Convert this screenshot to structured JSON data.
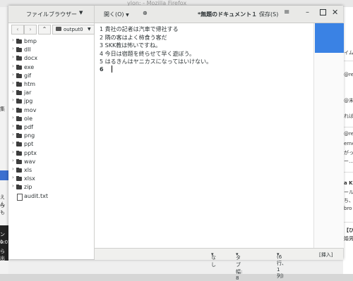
{
  "background": {
    "window_title": "ylon: - Mozilla Firefox",
    "left_fragments": [
      "集",
      "えん",
      "らも",
      "ンレ",
      "0.07",
      "ら出"
    ],
    "right_fragments": [
      "イム",
      "@re",
      "@末",
      "れば",
      "@re",
      "erne",
      "がっ",
      "ー…",
      "a K",
      "ール",
      "ち、",
      "bro",
      "【ひ",
      "婚男"
    ]
  },
  "header": {
    "file_browser_label": "ファイルブラウザー",
    "open_label": "開く(O)",
    "document_title": "*無題のドキュメント１",
    "save_label": "保存(S)"
  },
  "sidebar": {
    "path_label": "output0",
    "items": [
      {
        "name": "bmp",
        "type": "folder"
      },
      {
        "name": "dll",
        "type": "folder"
      },
      {
        "name": "docx",
        "type": "folder"
      },
      {
        "name": "exe",
        "type": "folder"
      },
      {
        "name": "gif",
        "type": "folder"
      },
      {
        "name": "htm",
        "type": "folder"
      },
      {
        "name": "jar",
        "type": "folder"
      },
      {
        "name": "jpg",
        "type": "folder"
      },
      {
        "name": "mov",
        "type": "folder"
      },
      {
        "name": "ole",
        "type": "folder"
      },
      {
        "name": "pdf",
        "type": "folder"
      },
      {
        "name": "png",
        "type": "folder"
      },
      {
        "name": "ppt",
        "type": "folder"
      },
      {
        "name": "pptx",
        "type": "folder"
      },
      {
        "name": "wav",
        "type": "folder"
      },
      {
        "name": "xls",
        "type": "folder"
      },
      {
        "name": "xlsx",
        "type": "folder"
      },
      {
        "name": "zip",
        "type": "folder"
      },
      {
        "name": "audit.txt",
        "type": "file"
      }
    ]
  },
  "editor": {
    "lines": [
      "1 貴社の記者は汽車で帰社する",
      "2 隣の客はよく柿食う客だ",
      "3 SKK教は怖いですね。",
      "4 今日は宿題を終らせて早く遊ぼう。",
      "5 はるきんはヤニカスになってはいけない。",
      "6"
    ]
  },
  "status": {
    "language": "なし",
    "tab_width": "タブ幅: 8",
    "position": "(6行、1列)",
    "insert_mode": "[挿入]"
  }
}
